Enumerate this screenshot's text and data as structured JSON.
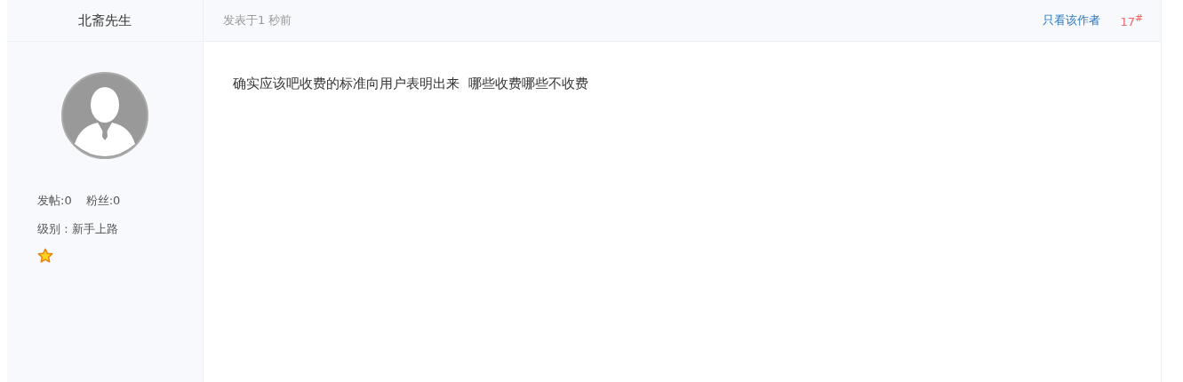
{
  "author": {
    "name": "北斋先生",
    "posts": "发帖:0",
    "fans": "粉丝:0",
    "level": "级别 : 新手上路"
  },
  "post": {
    "time": "发表于1 秒前",
    "only_author_link": "只看该作者",
    "floor": "17$^{#}$",
    "content": "确实应该吧收费的标准向用户表明出来  哪些收费哪些不收费"
  }
}
